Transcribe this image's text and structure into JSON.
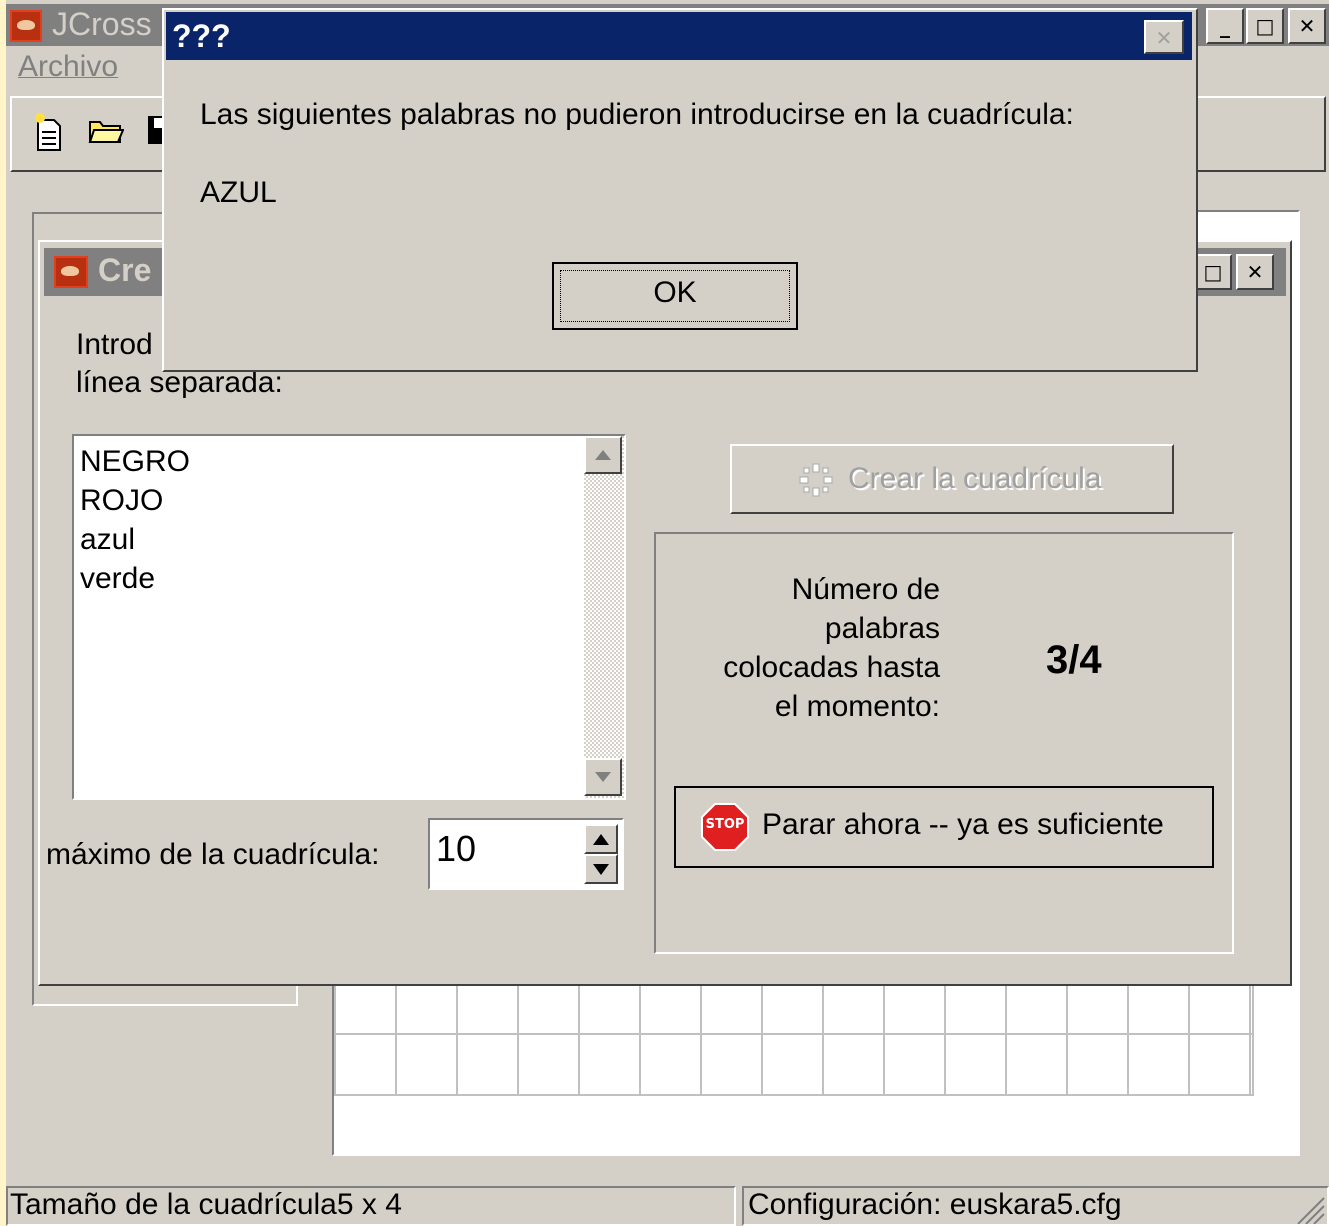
{
  "main_window": {
    "title": "JCross",
    "menu": {
      "archivo": "Archivo"
    },
    "controls": {
      "minimize": "_",
      "maximize": "□",
      "close": "✕"
    },
    "status_left": "Tamaño de la cuadrícula5 x 4",
    "status_right": "Configuración: euskara5.cfg"
  },
  "create_window": {
    "title": "Cre",
    "controls": {
      "maximize": "□",
      "close": "✕"
    },
    "prompt_line1": "Introd",
    "prompt_line2": "línea separada:",
    "words": [
      "NEGRO",
      "ROJO",
      "azul",
      "verde"
    ],
    "max_label": "máximo de la cuadrícula:",
    "max_value": "10",
    "create_button": "Crear la cuadrícula",
    "placed_label": [
      "Número de",
      "palabras",
      "colocadas hasta",
      "el momento:"
    ],
    "placed_value": "3/4",
    "stop_icon_text": "STOP",
    "stop_button": "Parar ahora -- ya es suficiente"
  },
  "alert_dialog": {
    "title": "???",
    "message": "Las siguientes palabras no pudieron introducirse en la cuadrícula:",
    "word": "AZUL",
    "ok": "OK"
  },
  "colors": {
    "title_bar": "#0a246a",
    "dialog_face": "#d4d0c8",
    "stop_red": "#e02020"
  }
}
